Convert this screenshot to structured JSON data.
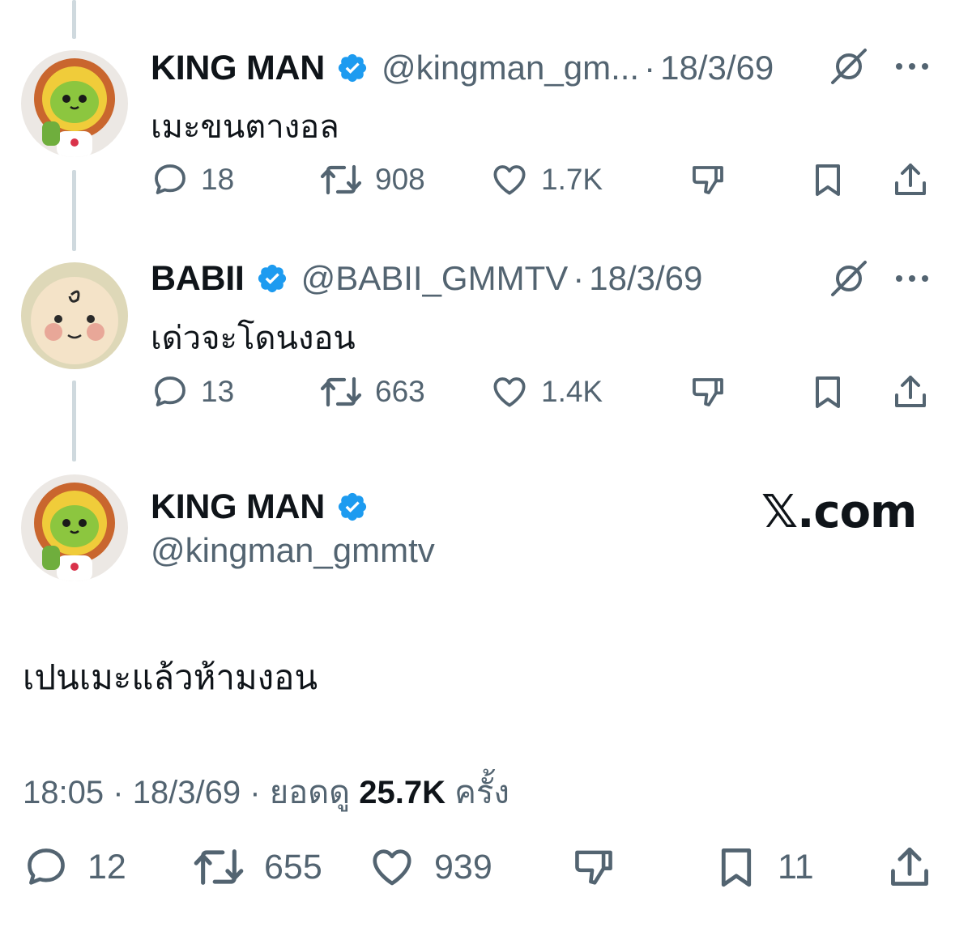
{
  "tweets": [
    {
      "name": "KING MAN",
      "handle": "@kingman_gm...",
      "date": "18/3/69",
      "text": "เมะขนตางอล",
      "replies": "18",
      "reposts": "908",
      "likes": "1.7K",
      "avatar": "lion-mascot-avatar"
    },
    {
      "name": "BABII",
      "handle": "@BABII_GMMTV",
      "date": "18/3/69",
      "text": "เด่วจะโดนงอน",
      "replies": "13",
      "reposts": "663",
      "likes": "1.4K",
      "avatar": "baby-face-avatar"
    }
  ],
  "main": {
    "name": "KING MAN",
    "handle": "@kingman_gmmtv",
    "text": "เปนเมะแล้วห้ามงอน",
    "time": "18:05",
    "date": "18/3/69",
    "views_prefix": "ยอดดู",
    "views": "25.7K",
    "views_suffix": "ครั้ง",
    "replies": "12",
    "reposts": "655",
    "likes": "939",
    "bookmarks": "11",
    "watermark": "𝕏.com"
  },
  "separator": "·",
  "colors": {
    "verified": "#1d9bf0",
    "text": "#0f1419",
    "secondary": "#536471",
    "thread_line": "#cfd9de"
  }
}
